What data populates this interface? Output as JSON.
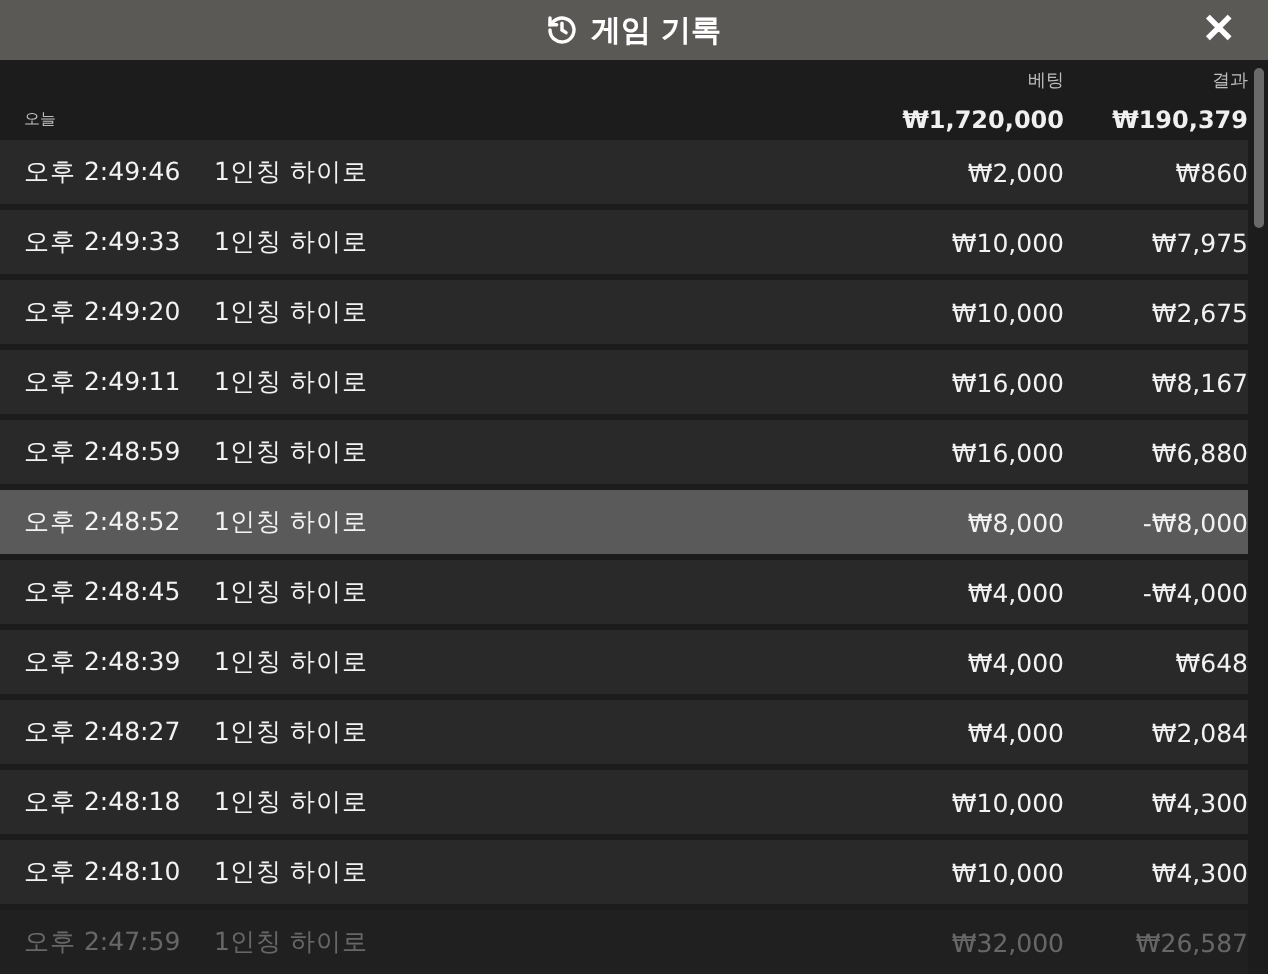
{
  "window": {
    "title": "게임 기록",
    "close": "✕"
  },
  "columns": {
    "bet": "베팅",
    "result": "결과"
  },
  "summary": {
    "label": "오늘",
    "bet": "₩1,720,000",
    "result": "₩190,379"
  },
  "rows": [
    {
      "time": "오후 2:49:46",
      "game": "1인칭 하이로",
      "bet": "₩2,000",
      "result": "₩860",
      "selected": false
    },
    {
      "time": "오후 2:49:33",
      "game": "1인칭 하이로",
      "bet": "₩10,000",
      "result": "₩7,975",
      "selected": false
    },
    {
      "time": "오후 2:49:20",
      "game": "1인칭 하이로",
      "bet": "₩10,000",
      "result": "₩2,675",
      "selected": false
    },
    {
      "time": "오후 2:49:11",
      "game": "1인칭 하이로",
      "bet": "₩16,000",
      "result": "₩8,167",
      "selected": false
    },
    {
      "time": "오후 2:48:59",
      "game": "1인칭 하이로",
      "bet": "₩16,000",
      "result": "₩6,880",
      "selected": false
    },
    {
      "time": "오후 2:48:52",
      "game": "1인칭 하이로",
      "bet": "₩8,000",
      "result": "-₩8,000",
      "selected": true
    },
    {
      "time": "오후 2:48:45",
      "game": "1인칭 하이로",
      "bet": "₩4,000",
      "result": "-₩4,000",
      "selected": false
    },
    {
      "time": "오후 2:48:39",
      "game": "1인칭 하이로",
      "bet": "₩4,000",
      "result": "₩648",
      "selected": false
    },
    {
      "time": "오후 2:48:27",
      "game": "1인칭 하이로",
      "bet": "₩4,000",
      "result": "₩2,084",
      "selected": false
    },
    {
      "time": "오후 2:48:18",
      "game": "1인칭 하이로",
      "bet": "₩10,000",
      "result": "₩4,300",
      "selected": false
    },
    {
      "time": "오후 2:48:10",
      "game": "1인칭 하이로",
      "bet": "₩10,000",
      "result": "₩4,300",
      "selected": false
    },
    {
      "time": "오후 2:47:59",
      "game": "1인칭 하이로",
      "bet": "₩32,000",
      "result": "₩26,587",
      "selected": false
    }
  ]
}
